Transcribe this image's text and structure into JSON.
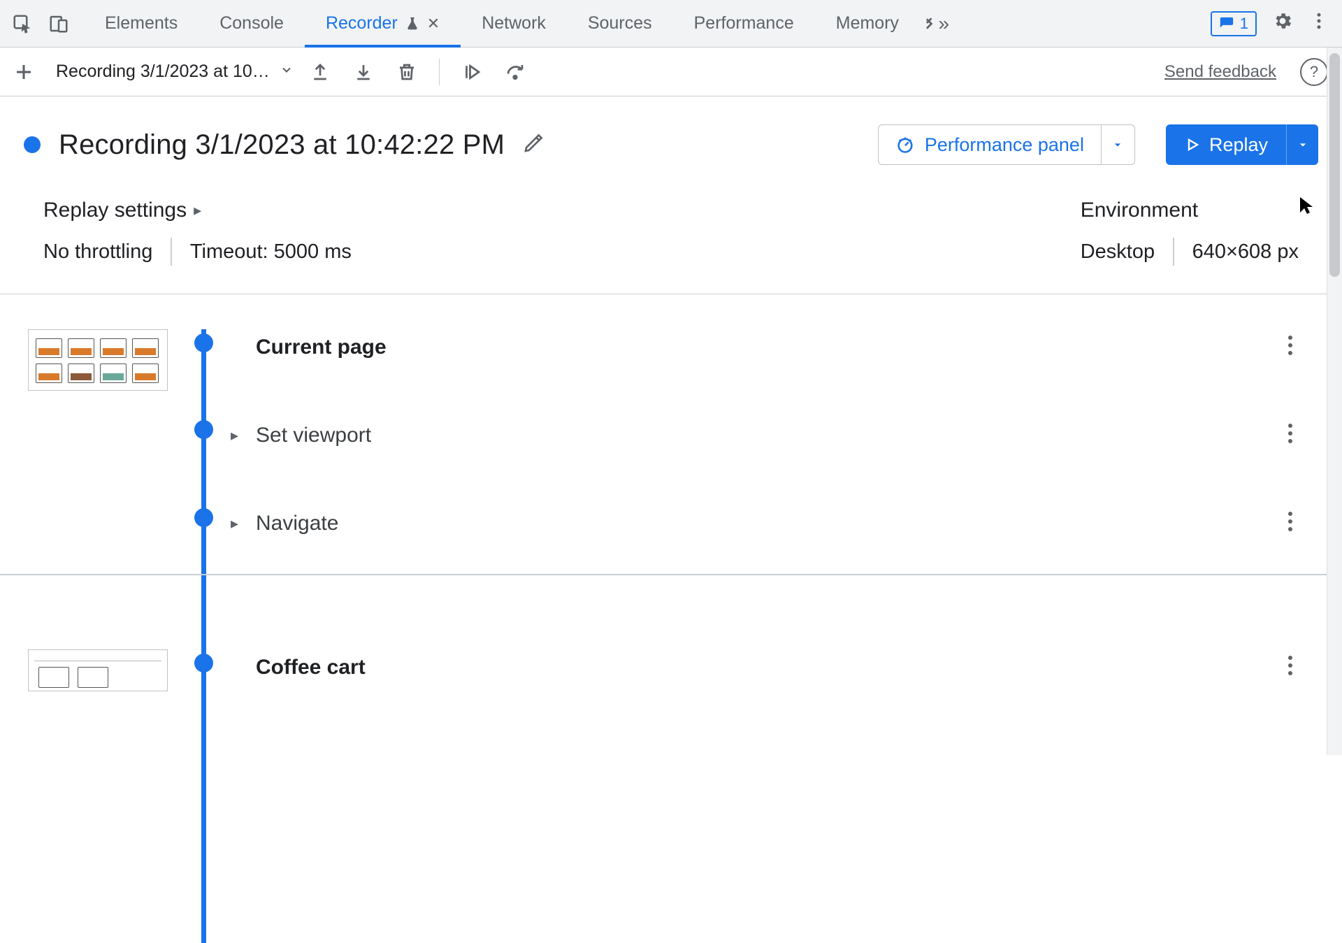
{
  "tabs": {
    "elements": "Elements",
    "console": "Console",
    "recorder": "Recorder",
    "network": "Network",
    "sources": "Sources",
    "performance": "Performance",
    "memory": "Memory"
  },
  "issues_count": "1",
  "toolbar": {
    "recording_select": "Recording 3/1/2023 at 10…",
    "feedback": "Send feedback"
  },
  "title": "Recording 3/1/2023 at 10:42:22 PM",
  "perf_panel_label": "Performance panel",
  "replay_label": "Replay",
  "replay_settings": {
    "heading": "Replay settings",
    "throttling": "No throttling",
    "timeout": "Timeout: 5000 ms"
  },
  "environment": {
    "heading": "Environment",
    "device": "Desktop",
    "viewport": "640×608 px"
  },
  "steps": {
    "current_page": "Current page",
    "set_viewport": "Set viewport",
    "navigate": "Navigate",
    "coffee_cart": "Coffee cart"
  }
}
